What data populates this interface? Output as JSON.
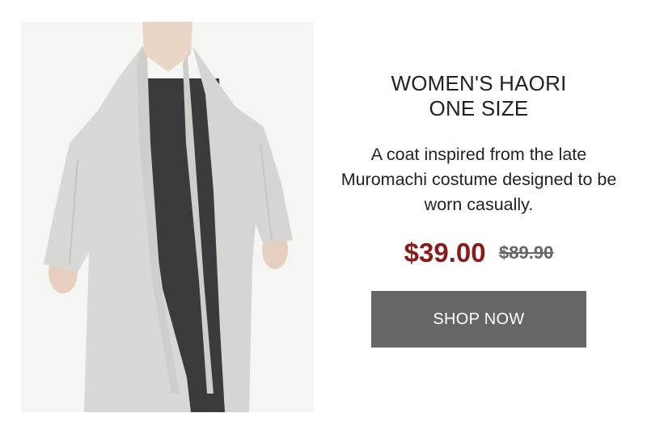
{
  "product": {
    "title_line1": "WOMEN'S HAORI",
    "title_line2": "ONE SIZE",
    "description": "A coat inspired from the late Muromachi costume designed to be worn casually.",
    "sale_price": "$39.00",
    "original_price": "$89.90",
    "cta_label": "SHOP NOW",
    "image_description": "model wearing a light grey haori coat over a dark charcoal dress"
  },
  "colors": {
    "sale_price": "#8b1a1a",
    "original_price": "#666666",
    "button_bg": "#666666",
    "button_text": "#ffffff",
    "coat": "#d9d8d5",
    "dress": "#3a3b3d",
    "photo_bg": "#f5f5f3"
  }
}
